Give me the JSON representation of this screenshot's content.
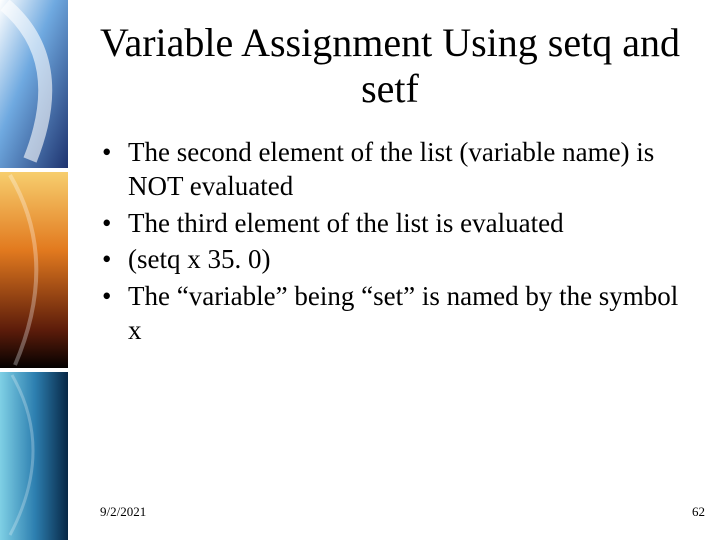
{
  "title": "Variable Assignment Using setq and setf",
  "bullets": [
    "The second element of the list (variable name) is NOT evaluated",
    "The third element of the list is evaluated",
    "(setq  x  35. 0)",
    "The “variable” being “set” is named by the symbol  x"
  ],
  "footer": {
    "date": "9/2/2021",
    "page": "62"
  }
}
